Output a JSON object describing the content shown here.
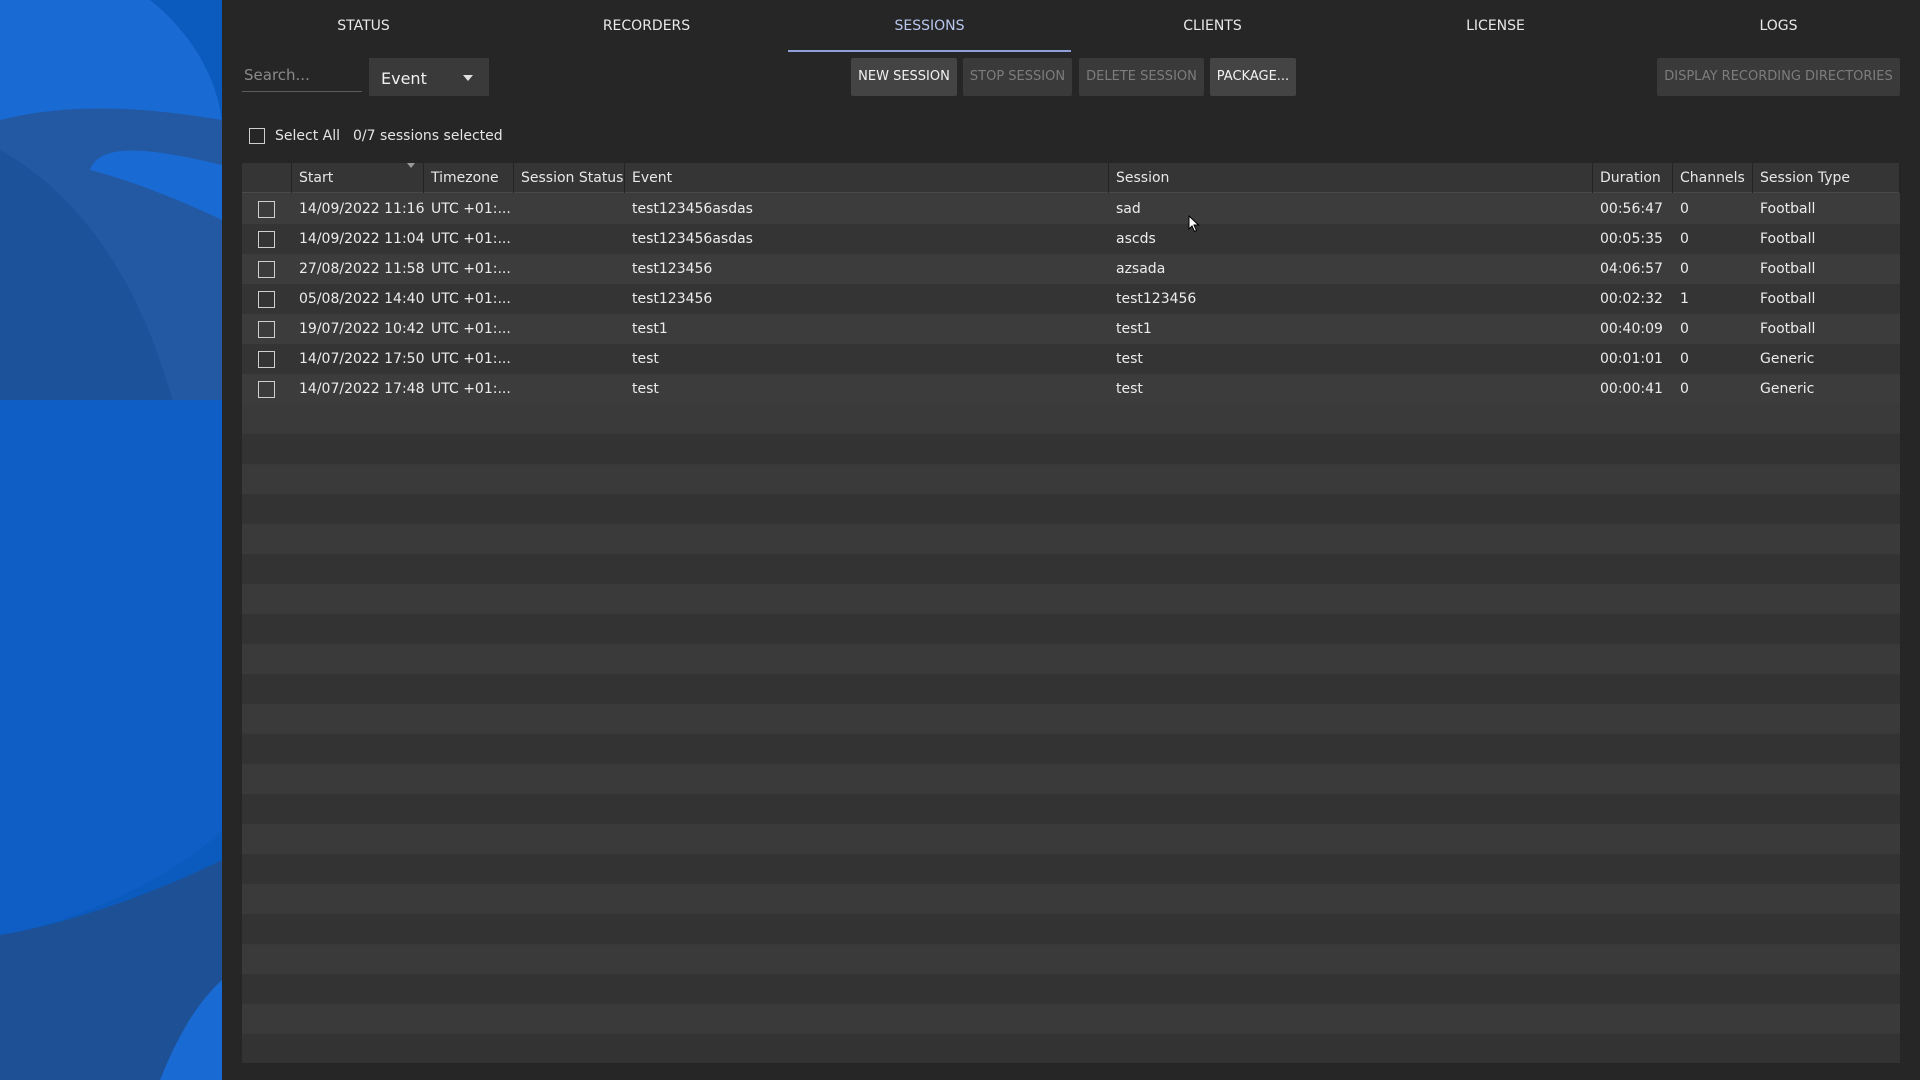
{
  "nav": {
    "tabs": [
      {
        "label": "STATUS"
      },
      {
        "label": "RECORDERS"
      },
      {
        "label": "SESSIONS"
      },
      {
        "label": "CLIENTS"
      },
      {
        "label": "LICENSE"
      },
      {
        "label": "LOGS"
      }
    ],
    "active": "SESSIONS"
  },
  "toolbar": {
    "search_placeholder": "Search...",
    "filter_value": "Event",
    "new_session_label": "NEW SESSION",
    "stop_session_label": "STOP SESSION",
    "delete_session_label": "DELETE SESSION",
    "package_label": "PACKAGE...",
    "display_dirs_label": "DISPLAY RECORDING DIRECTORIES"
  },
  "selection": {
    "select_all_label": "Select All",
    "count_text": "0/7 sessions selected"
  },
  "table": {
    "columns": [
      "Start",
      "Timezone",
      "Session Status",
      "Event",
      "Session",
      "Duration",
      "Channels",
      "Session Type"
    ],
    "rows": [
      {
        "start": "14/09/2022 11:16",
        "timezone": "UTC +01:...",
        "status": "",
        "event": "test123456asdas",
        "session": "sad",
        "duration": "00:56:47",
        "channels": "0",
        "type": "Football"
      },
      {
        "start": "14/09/2022 11:04",
        "timezone": "UTC +01:...",
        "status": "",
        "event": "test123456asdas",
        "session": "ascds",
        "duration": "00:05:35",
        "channels": "0",
        "type": "Football"
      },
      {
        "start": "27/08/2022 11:58",
        "timezone": "UTC +01:...",
        "status": "",
        "event": "test123456",
        "session": "azsada",
        "duration": "04:06:57",
        "channels": "0",
        "type": "Football"
      },
      {
        "start": "05/08/2022 14:40",
        "timezone": "UTC +01:...",
        "status": "",
        "event": "test123456",
        "session": "test123456",
        "duration": "00:02:32",
        "channels": "1",
        "type": "Football"
      },
      {
        "start": "19/07/2022 10:42",
        "timezone": "UTC +01:...",
        "status": "",
        "event": "test1",
        "session": "test1",
        "duration": "00:40:09",
        "channels": "0",
        "type": "Football"
      },
      {
        "start": "14/07/2022 17:50",
        "timezone": "UTC +01:...",
        "status": "",
        "event": "test",
        "session": "test",
        "duration": "00:01:01",
        "channels": "0",
        "type": "Generic"
      },
      {
        "start": "14/07/2022 17:48",
        "timezone": "UTC +01:...",
        "status": "",
        "event": "test",
        "session": "test",
        "duration": "00:00:41",
        "channels": "0",
        "type": "Generic"
      }
    ]
  },
  "colors": {
    "background": "#262626",
    "side_panel_blue": "#0d5fc4",
    "active_tab": "#b9c7ee"
  }
}
